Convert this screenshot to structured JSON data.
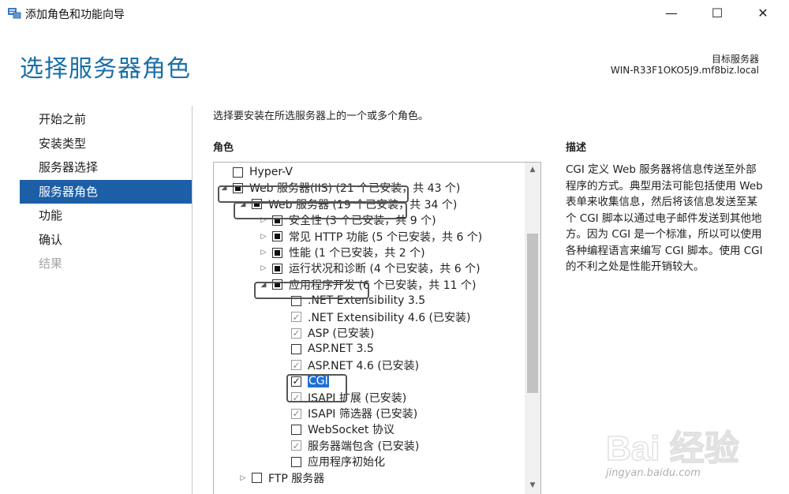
{
  "window": {
    "title": "添加角色和功能向导",
    "minimize": "—",
    "maximize": "☐",
    "close": "✕"
  },
  "header": {
    "page_title": "选择服务器角色",
    "target_label": "目标服务器",
    "target_value": "WIN-R33F1OKO5J9.mf8biz.local"
  },
  "nav": {
    "items": [
      {
        "label": "开始之前",
        "state": "normal"
      },
      {
        "label": "安装类型",
        "state": "normal"
      },
      {
        "label": "服务器选择",
        "state": "normal"
      },
      {
        "label": "服务器角色",
        "state": "active"
      },
      {
        "label": "功能",
        "state": "normal"
      },
      {
        "label": "确认",
        "state": "normal"
      },
      {
        "label": "结果",
        "state": "disabled"
      }
    ]
  },
  "content": {
    "instruction": "选择要安装在所选服务器上的一个或多个角色。",
    "roles_heading": "角色",
    "description_heading": "描述",
    "description_text": "CGI 定义 Web 服务器将信息传送至外部程序的方式。典型用法可能包括使用 Web 表单来收集信息，然后将该信息发送至某个 CGI 脚本以通过电子邮件发送到其他地方。因为 CGI 是一个标准，所以可以使用各种编程语言来编写 CGI 脚本。使用 CGI 的不利之处是性能开销较大。"
  },
  "tree": {
    "rows": [
      {
        "label": "Hyper-V",
        "state": "unchecked",
        "expander": "",
        "level": 0
      },
      {
        "label": "Web 服务器(IIS) (21 个已安装，共 43 个)",
        "state": "partial",
        "expander": "▲",
        "level": 0
      },
      {
        "label": "Web 服务器 (19 个已安装，共 34 个)",
        "state": "partial",
        "expander": "▲",
        "level": 1
      },
      {
        "label": "安全性 (3 个已安装，共 9 个)",
        "state": "partial",
        "expander": "▷",
        "level": 2
      },
      {
        "label": "常见 HTTP 功能 (5 个已安装，共 6 个)",
        "state": "partial",
        "expander": "▷",
        "level": 2
      },
      {
        "label": "性能 (1 个已安装，共 2 个)",
        "state": "partial",
        "expander": "▷",
        "level": 2
      },
      {
        "label": "运行状况和诊断 (4 个已安装，共 6 个)",
        "state": "partial",
        "expander": "▷",
        "level": 2
      },
      {
        "label": "应用程序开发 (6 个已安装，共 11 个)",
        "state": "partial",
        "expander": "▲",
        "level": 2
      },
      {
        "label": ".NET Extensibility 3.5",
        "state": "unchecked",
        "expander": "",
        "level": 3
      },
      {
        "label": ".NET Extensibility 4.6 (已安装)",
        "state": "installed",
        "expander": "",
        "level": 3
      },
      {
        "label": "ASP (已安装)",
        "state": "installed",
        "expander": "",
        "level": 3
      },
      {
        "label": "ASP.NET 3.5",
        "state": "unchecked",
        "expander": "",
        "level": 3
      },
      {
        "label": "ASP.NET 4.6 (已安装)",
        "state": "installed",
        "expander": "",
        "level": 3
      },
      {
        "label": "CGI",
        "state": "checked",
        "expander": "",
        "level": 3,
        "selected": true
      },
      {
        "label": "ISAPI 扩展 (已安装)",
        "state": "installed",
        "expander": "",
        "level": 3
      },
      {
        "label": "ISAPI 筛选器 (已安装)",
        "state": "installed",
        "expander": "",
        "level": 3
      },
      {
        "label": "WebSocket 协议",
        "state": "unchecked",
        "expander": "",
        "level": 3
      },
      {
        "label": "服务器端包含 (已安装)",
        "state": "installed",
        "expander": "",
        "level": 3
      },
      {
        "label": "应用程序初始化",
        "state": "unchecked",
        "expander": "",
        "level": 3
      },
      {
        "label": "FTP 服务器",
        "state": "unchecked",
        "expander": "▷",
        "level": 1
      }
    ]
  },
  "watermark": {
    "brand": "Bai 经验",
    "url": "jingyan.baidu.com"
  },
  "colors": {
    "accent": "#1c5fa6",
    "title_blue": "#1a6fa8",
    "selection": "#1f6fd4"
  }
}
